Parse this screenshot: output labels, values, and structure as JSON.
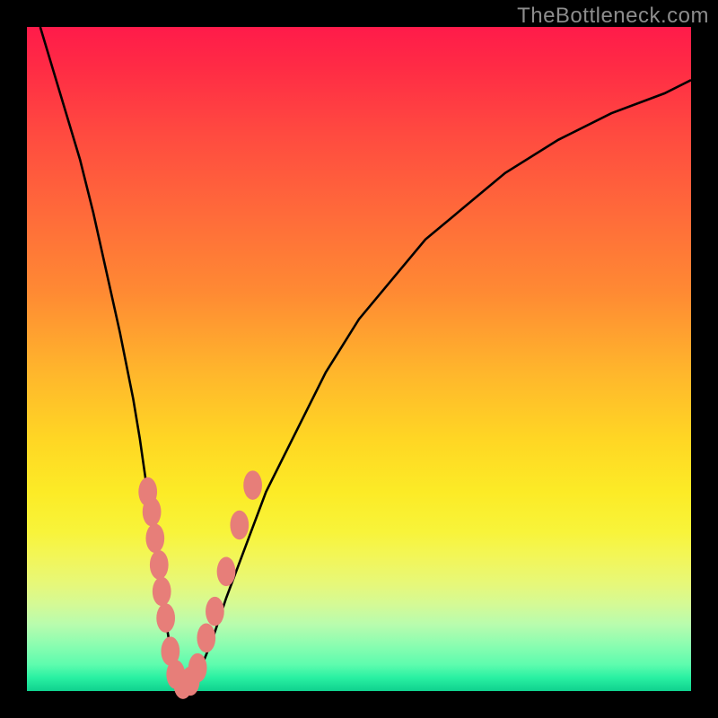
{
  "watermark": "TheBottleneck.com",
  "colors": {
    "frame": "#000000",
    "curve": "#000000",
    "marker": "#e77e79"
  },
  "chart_data": {
    "type": "line",
    "title": "",
    "xlabel": "",
    "ylabel": "",
    "xlim": [
      0,
      100
    ],
    "ylim": [
      0,
      100
    ],
    "grid": false,
    "legend": false,
    "series": [
      {
        "name": "curve",
        "x": [
          2,
          5,
          8,
          10,
          12,
          14,
          16,
          17,
          18,
          19,
          20,
          21,
          22,
          23,
          24,
          25,
          26,
          28,
          30,
          33,
          36,
          40,
          45,
          50,
          55,
          60,
          66,
          72,
          80,
          88,
          96,
          100
        ],
        "y": [
          100,
          90,
          80,
          72,
          63,
          54,
          44,
          38,
          31,
          24,
          16,
          10,
          4,
          1,
          0.5,
          1,
          3,
          8,
          14,
          22,
          30,
          38,
          48,
          56,
          62,
          68,
          73,
          78,
          83,
          87,
          90,
          92
        ]
      }
    ],
    "markers": [
      {
        "x": 18.2,
        "y": 30
      },
      {
        "x": 18.8,
        "y": 27
      },
      {
        "x": 19.3,
        "y": 23
      },
      {
        "x": 19.9,
        "y": 19
      },
      {
        "x": 20.3,
        "y": 15
      },
      {
        "x": 20.9,
        "y": 11
      },
      {
        "x": 21.6,
        "y": 6
      },
      {
        "x": 22.4,
        "y": 2.5
      },
      {
        "x": 23.5,
        "y": 1
      },
      {
        "x": 24.6,
        "y": 1.5
      },
      {
        "x": 25.7,
        "y": 3.5
      },
      {
        "x": 27.0,
        "y": 8
      },
      {
        "x": 28.3,
        "y": 12
      },
      {
        "x": 30.0,
        "y": 18
      },
      {
        "x": 32.0,
        "y": 25
      },
      {
        "x": 34.0,
        "y": 31
      }
    ],
    "marker_rx": 1.4,
    "marker_ry": 2.2
  }
}
